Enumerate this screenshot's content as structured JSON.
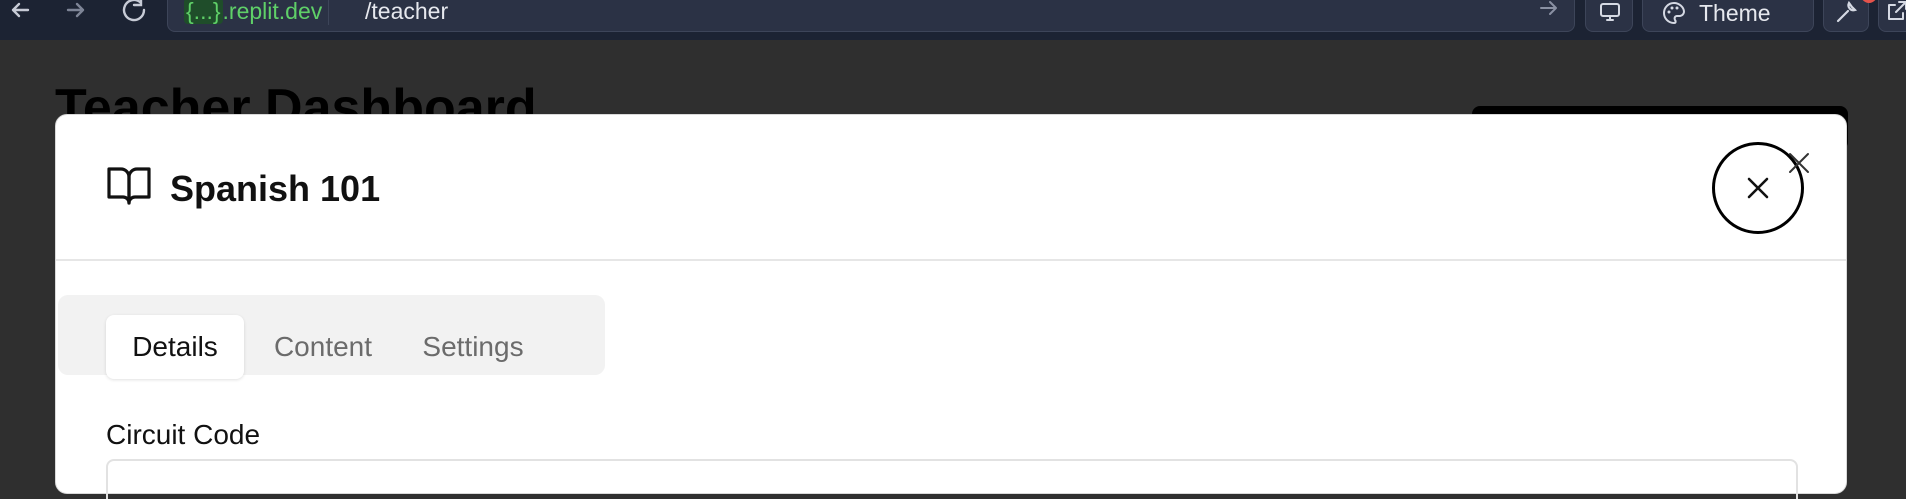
{
  "browser": {
    "url_host_brace": "{...}",
    "url_host_suffix": ".replit.dev",
    "url_path": "/teacher",
    "theme_label": "Theme"
  },
  "page": {
    "title": "Teacher Dashboard"
  },
  "modal": {
    "title": "Spanish 101",
    "tabs": [
      {
        "label": "Details",
        "active": true
      },
      {
        "label": "Content",
        "active": false
      },
      {
        "label": "Settings",
        "active": false
      }
    ],
    "field_label": "Circuit Code"
  },
  "colors": {
    "chrome_bg": "#1c2333",
    "url_host": "#5fd068",
    "overlay": "#2f2f2f",
    "notification_badge": "#e5534b"
  }
}
